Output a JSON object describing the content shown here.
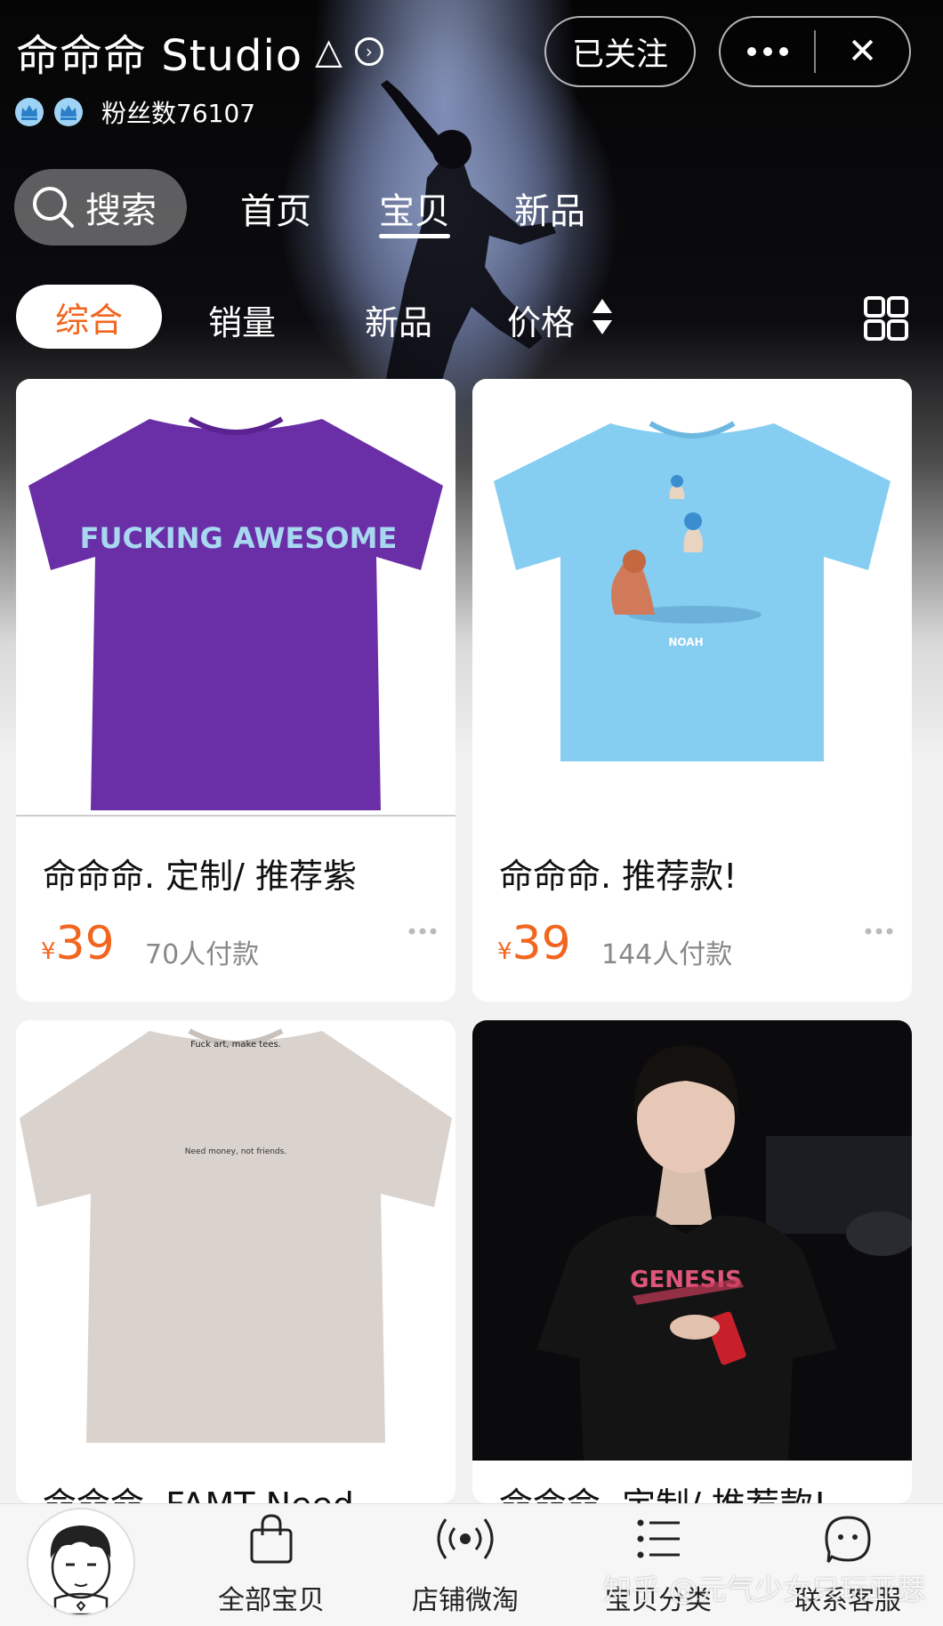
{
  "header": {
    "shop_name": "命命命  Studio",
    "triangle": "△",
    "follow_label": "已关注",
    "fans_text": "粉丝数76107"
  },
  "nav": {
    "search_label": "搜索",
    "tabs": [
      "首页",
      "宝贝",
      "新品"
    ],
    "active_tab": "宝贝"
  },
  "sort": {
    "items": [
      "综合",
      "销量",
      "新品",
      "价格"
    ],
    "active": "综合"
  },
  "products": [
    {
      "title": "命命命. 定制/ 推荐紫",
      "currency": "¥",
      "price": "39",
      "sales": "70人付款",
      "shirt_color": "#6a2fa6",
      "print_text": "FUCKING AWESOME"
    },
    {
      "title": "命命命. 推荐款!",
      "currency": "¥",
      "price": "39",
      "sales": "144人付款",
      "shirt_color": "#86cdf2",
      "print_text": "NOAH"
    },
    {
      "title": "命命命. FAMT Need",
      "shirt_color": "#d9d2cd",
      "collar_text": "Fuck art, make tees.",
      "print_text": "Need money, not friends."
    },
    {
      "title": "命命命. 定制/ 推荐款!",
      "shirt_color": "#141414",
      "print_text": "GENESIS"
    }
  ],
  "bottom_bar": {
    "tabs": [
      {
        "label": "全部宝贝",
        "icon": "shopping-bag-icon"
      },
      {
        "label": "店铺微淘",
        "icon": "broadcast-icon"
      },
      {
        "label": "宝贝分类",
        "icon": "list-icon"
      },
      {
        "label": "联系客服",
        "icon": "chat-bubble-icon"
      }
    ]
  },
  "watermark": "知乎 @元气少女只玩亚瑟",
  "colors": {
    "accent": "#f2651e",
    "text_dark": "#111111",
    "text_muted": "#888888"
  }
}
